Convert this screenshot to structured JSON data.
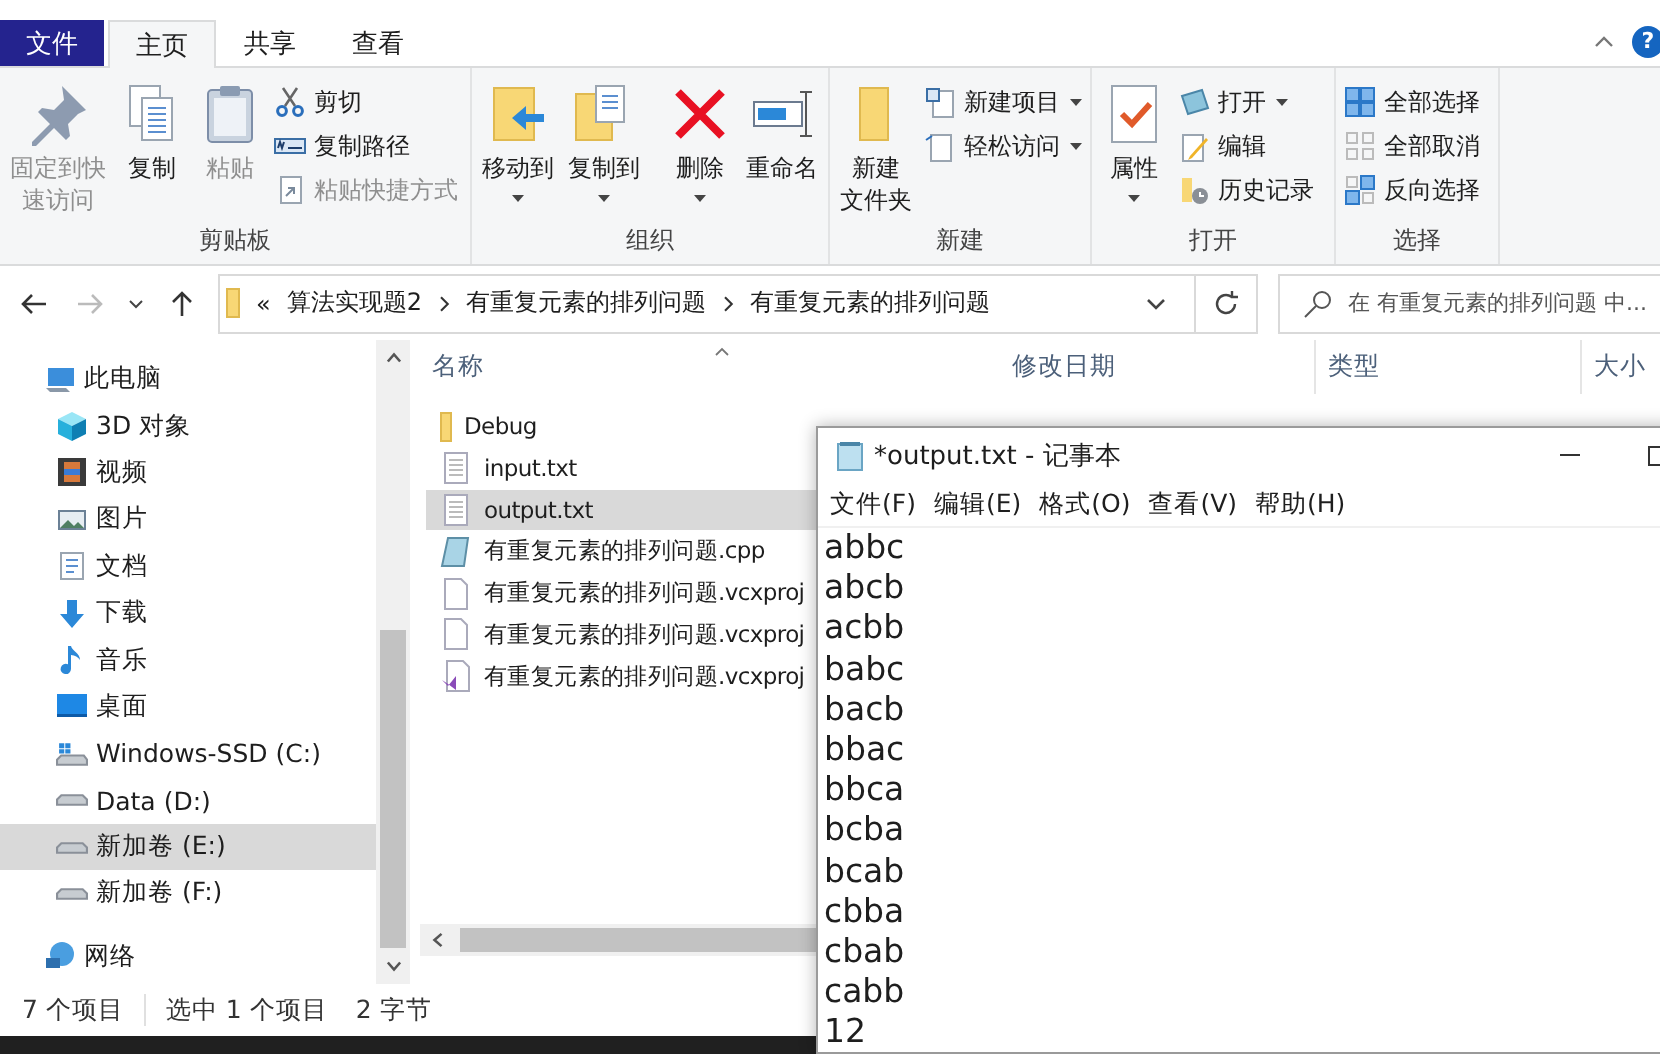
{
  "tabs": [
    {
      "label": "文件",
      "kind": "file",
      "selected": false
    },
    {
      "label": "主页",
      "kind": "tab",
      "selected": true
    },
    {
      "label": "共享",
      "kind": "tab",
      "selected": false
    },
    {
      "label": "查看",
      "kind": "tab",
      "selected": false
    }
  ],
  "help_button": {
    "label": "?"
  },
  "ribbon": [
    {
      "title": "剪贴板",
      "items": [
        {
          "kind": "large",
          "lines": [
            "固定到快",
            "速访问"
          ],
          "disabled": true,
          "dropdown": false
        },
        {
          "kind": "large",
          "lines": [
            "复制"
          ],
          "disabled": false,
          "dropdown": false
        },
        {
          "kind": "large",
          "lines": [
            "粘贴"
          ],
          "disabled": true,
          "dropdown": false
        },
        {
          "kind": "stack",
          "items": [
            {
              "label": "剪切",
              "disabled": false,
              "dropdown": false
            },
            {
              "label": "复制路径",
              "disabled": false,
              "dropdown": false
            },
            {
              "label": "粘贴快捷方式",
              "disabled": true,
              "dropdown": false
            }
          ]
        }
      ]
    },
    {
      "title": "组织",
      "items": [
        {
          "kind": "large",
          "lines": [
            "移动到"
          ],
          "disabled": false,
          "dropdown": true
        },
        {
          "kind": "large",
          "lines": [
            "复制到"
          ],
          "disabled": false,
          "dropdown": true
        },
        {
          "kind": "separator"
        },
        {
          "kind": "large",
          "lines": [
            "删除"
          ],
          "disabled": false,
          "dropdown": true
        },
        {
          "kind": "large",
          "lines": [
            "重命名"
          ],
          "disabled": false,
          "dropdown": false
        }
      ]
    },
    {
      "title": "新建",
      "items": [
        {
          "kind": "large",
          "lines": [
            "新建",
            "文件夹"
          ],
          "disabled": false,
          "dropdown": false
        },
        {
          "kind": "stack",
          "items": [
            {
              "label": "新建项目",
              "disabled": false,
              "dropdown": true
            },
            {
              "label": "轻松访问",
              "disabled": false,
              "dropdown": true
            }
          ]
        }
      ]
    },
    {
      "title": "打开",
      "items": [
        {
          "kind": "large",
          "lines": [
            "属性"
          ],
          "disabled": false,
          "dropdown": true
        },
        {
          "kind": "stack",
          "items": [
            {
              "label": "打开",
              "disabled": false,
              "dropdown": true
            },
            {
              "label": "编辑",
              "disabled": false,
              "dropdown": false
            },
            {
              "label": "历史记录",
              "disabled": false,
              "dropdown": false
            }
          ]
        }
      ]
    },
    {
      "title": "选择",
      "items": [
        {
          "kind": "stack",
          "items": [
            {
              "label": "全部选择",
              "disabled": false,
              "dropdown": false
            },
            {
              "label": "全部取消",
              "disabled": false,
              "dropdown": false
            },
            {
              "label": "反向选择",
              "disabled": false,
              "dropdown": false
            }
          ]
        }
      ]
    }
  ],
  "address": {
    "overflow": "«",
    "crumbs": [
      "算法实现题2",
      "有重复元素的排列问题",
      "有重复元素的排列问题"
    ]
  },
  "search": {
    "placeholder": "在 有重复元素的排列问题 中..."
  },
  "sidebar": {
    "items": [
      {
        "label": "此电脑",
        "selected": false,
        "children": [
          {
            "label": "3D 对象",
            "selected": false
          },
          {
            "label": "视频",
            "selected": false
          },
          {
            "label": "图片",
            "selected": false
          },
          {
            "label": "文档",
            "selected": false
          },
          {
            "label": "下载",
            "selected": false
          },
          {
            "label": "音乐",
            "selected": false
          },
          {
            "label": "桌面",
            "selected": false
          },
          {
            "label": "Windows-SSD (C:)",
            "selected": false
          },
          {
            "label": "Data (D:)",
            "selected": false
          },
          {
            "label": "新加卷 (E:)",
            "selected": true
          },
          {
            "label": "新加卷 (F:)",
            "selected": false
          }
        ]
      },
      {
        "label": "网络",
        "selected": false
      }
    ]
  },
  "files": {
    "columns": [
      "名称",
      "修改日期",
      "类型",
      "大小"
    ],
    "rows": [
      {
        "name": "Debug",
        "kind": "folder",
        "selected": false
      },
      {
        "name": "input.txt",
        "kind": "text",
        "selected": false
      },
      {
        "name": "output.txt",
        "kind": "text",
        "selected": true
      },
      {
        "name": "有重复元素的排列问题.cpp",
        "kind": "cpp",
        "selected": false
      },
      {
        "name": "有重复元素的排列问题.vcxproj",
        "kind": "file",
        "selected": false
      },
      {
        "name": "有重复元素的排列问题.vcxproj",
        "kind": "file",
        "selected": false
      },
      {
        "name": "有重复元素的排列问题.vcxproj",
        "kind": "vs",
        "selected": false
      }
    ]
  },
  "status_bar": {
    "count": "7 个项目",
    "selection": "选中 1 个项目",
    "size": "2 字节"
  },
  "notepad": {
    "title": "*output.txt - 记事本",
    "menu": [
      "文件(F)",
      "编辑(E)",
      "格式(O)",
      "查看(V)",
      "帮助(H)"
    ],
    "lines": [
      "abbc",
      "abcb",
      "acbb",
      "babc",
      "bacb",
      "bbac",
      "bbca",
      "bcba",
      "bcab",
      "cbba",
      "cbab",
      "cabb",
      "12"
    ]
  }
}
